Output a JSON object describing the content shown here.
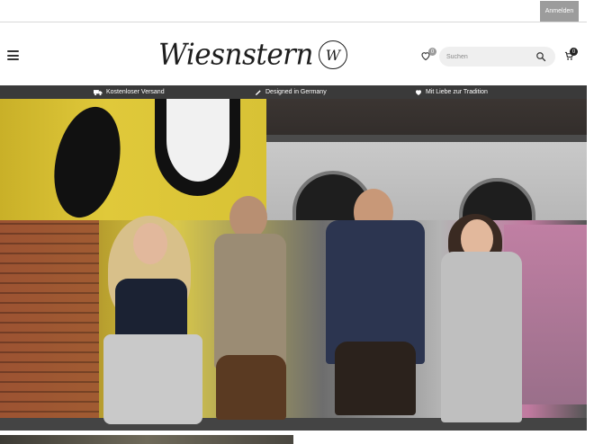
{
  "topbar": {
    "login_label": "Anmelden"
  },
  "header": {
    "logo_text": "Wiesnstern",
    "logo_monogram": "W",
    "wishlist_count": "0",
    "search_placeholder": "Suchen",
    "cart_count": "0"
  },
  "usp": [
    {
      "icon": "truck-icon",
      "label": "Kostenloser Versand"
    },
    {
      "icon": "pen-icon",
      "label": "Designed in Germany"
    },
    {
      "icon": "heart-icon",
      "label": "Mit Liebe zur Tradition"
    }
  ],
  "colors": {
    "usp_bar": "#3a3a3a",
    "login_button": "#9c9c9c",
    "search_bg": "#efefef"
  }
}
